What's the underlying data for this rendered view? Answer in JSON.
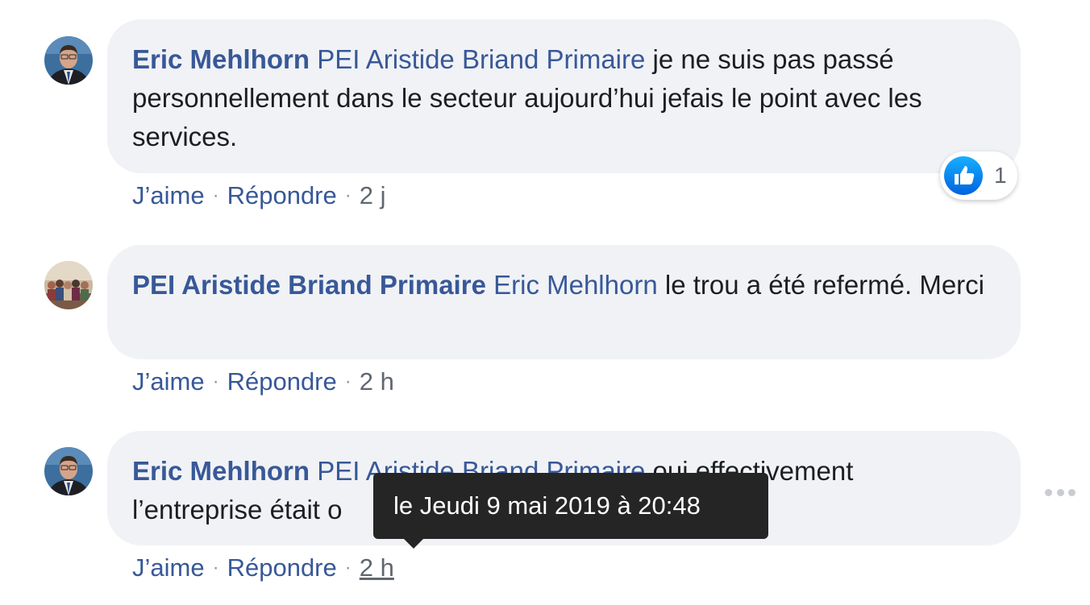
{
  "comments": [
    {
      "author": "Eric Mehlhorn",
      "mention": "PEI Aristide Briand Primaire",
      "text": "je ne suis pas passé personnellement dans le secteur aujourd’hui jefais le point avec les services.",
      "like_label": "J’aime",
      "reply_label": "Répondre",
      "time": "2 j",
      "reaction_count": "1",
      "avatar_icon": "person-avatar"
    },
    {
      "author": "PEI Aristide Briand Primaire",
      "mention": "Eric Mehlhorn",
      "text": "le trou a été refermé. Merci",
      "like_label": "J’aime",
      "reply_label": "Répondre",
      "time": "2 h",
      "avatar_icon": "group-photo-avatar"
    },
    {
      "author": "Eric Mehlhorn",
      "mention": "PEI Aristide Briand Primaire",
      "text": "oui effectivement l’entreprise était o",
      "like_label": "J’aime",
      "reply_label": "Répondre",
      "time": "2 h",
      "avatar_icon": "person-avatar"
    }
  ],
  "separator": "·",
  "tooltip": {
    "text": "le Jeudi 9 mai 2019 à 20:48"
  },
  "icons": {
    "like": "thumbs-up-icon",
    "more": "more-options-icon"
  },
  "colors": {
    "link": "#385898",
    "bubble": "#f0f2f5",
    "like_blue": "#1877f2",
    "tooltip_bg": "#252526"
  }
}
